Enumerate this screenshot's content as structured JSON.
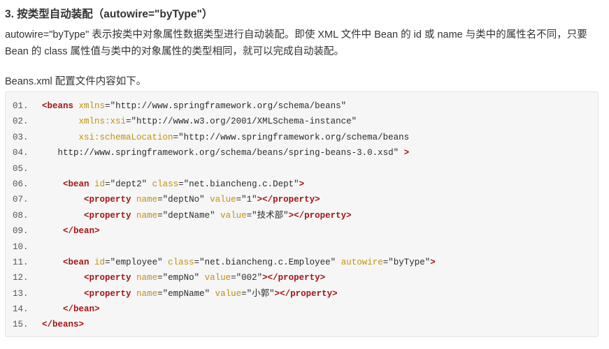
{
  "heading": "3. 按类型自动装配（autowire=\"byType\"）",
  "paragraph": [
    "autowire=\"byType\" 表示按类中对象属性数据类型进行自动装配。即使 XML 文件中 Bean 的 id 或 name 与类中的属性名不同，只要",
    "Bean 的 class 属性值与类中的对象属性的类型相同，就可以完成自动装配。"
  ],
  "intro": "Beans.xml 配置文件内容如下。",
  "code": {
    "language": "xml",
    "lines": [
      {
        "num": "01.",
        "tokens": [
          [
            "t",
            "<beans"
          ],
          [
            "p",
            " "
          ],
          [
            "a",
            "xmlns"
          ],
          [
            "p",
            "="
          ],
          [
            "v",
            "\"http://www.springframework.org/schema/beans\""
          ]
        ]
      },
      {
        "num": "02.",
        "tokens": [
          [
            "p",
            "       "
          ],
          [
            "a",
            "xmlns:xsi"
          ],
          [
            "p",
            "="
          ],
          [
            "v",
            "\"http://www.w3.org/2001/XMLSchema-instance\""
          ]
        ]
      },
      {
        "num": "03.",
        "tokens": [
          [
            "p",
            "       "
          ],
          [
            "a",
            "xsi:schemaLocation"
          ],
          [
            "p",
            "="
          ],
          [
            "v",
            "\"http://www.springframework.org/schema/beans"
          ]
        ]
      },
      {
        "num": "04.",
        "tokens": [
          [
            "v",
            "   http://www.springframework.org/schema/beans/spring-beans-3.0.xsd\""
          ],
          [
            "p",
            " "
          ],
          [
            "t",
            ">"
          ]
        ]
      },
      {
        "num": "05.",
        "tokens": []
      },
      {
        "num": "06.",
        "tokens": [
          [
            "p",
            "    "
          ],
          [
            "t",
            "<bean"
          ],
          [
            "p",
            " "
          ],
          [
            "a",
            "id"
          ],
          [
            "p",
            "="
          ],
          [
            "v",
            "\"dept2\""
          ],
          [
            "p",
            " "
          ],
          [
            "a",
            "class"
          ],
          [
            "p",
            "="
          ],
          [
            "v",
            "\"net.biancheng.c.Dept\""
          ],
          [
            "t",
            ">"
          ]
        ]
      },
      {
        "num": "07.",
        "tokens": [
          [
            "p",
            "        "
          ],
          [
            "t",
            "<property"
          ],
          [
            "p",
            " "
          ],
          [
            "a",
            "name"
          ],
          [
            "p",
            "="
          ],
          [
            "v",
            "\"deptNo\""
          ],
          [
            "p",
            " "
          ],
          [
            "a",
            "value"
          ],
          [
            "p",
            "="
          ],
          [
            "v",
            "\"1\""
          ],
          [
            "t",
            "></property>"
          ]
        ]
      },
      {
        "num": "08.",
        "tokens": [
          [
            "p",
            "        "
          ],
          [
            "t",
            "<property"
          ],
          [
            "p",
            " "
          ],
          [
            "a",
            "name"
          ],
          [
            "p",
            "="
          ],
          [
            "v",
            "\"deptName\""
          ],
          [
            "p",
            " "
          ],
          [
            "a",
            "value"
          ],
          [
            "p",
            "="
          ],
          [
            "v",
            "\"技术部\""
          ],
          [
            "t",
            "></property>"
          ]
        ]
      },
      {
        "num": "09.",
        "tokens": [
          [
            "p",
            "    "
          ],
          [
            "t",
            "</bean>"
          ]
        ]
      },
      {
        "num": "10.",
        "tokens": []
      },
      {
        "num": "11.",
        "tokens": [
          [
            "p",
            "    "
          ],
          [
            "t",
            "<bean"
          ],
          [
            "p",
            " "
          ],
          [
            "a",
            "id"
          ],
          [
            "p",
            "="
          ],
          [
            "v",
            "\"employee\""
          ],
          [
            "p",
            " "
          ],
          [
            "a",
            "class"
          ],
          [
            "p",
            "="
          ],
          [
            "v",
            "\"net.biancheng.c.Employee\""
          ],
          [
            "p",
            " "
          ],
          [
            "a",
            "autowire"
          ],
          [
            "p",
            "="
          ],
          [
            "v",
            "\"byType\""
          ],
          [
            "t",
            ">"
          ]
        ]
      },
      {
        "num": "12.",
        "tokens": [
          [
            "p",
            "        "
          ],
          [
            "t",
            "<property"
          ],
          [
            "p",
            " "
          ],
          [
            "a",
            "name"
          ],
          [
            "p",
            "="
          ],
          [
            "v",
            "\"empNo\""
          ],
          [
            "p",
            " "
          ],
          [
            "a",
            "value"
          ],
          [
            "p",
            "="
          ],
          [
            "v",
            "\"002\""
          ],
          [
            "t",
            "></property>"
          ]
        ]
      },
      {
        "num": "13.",
        "tokens": [
          [
            "p",
            "        "
          ],
          [
            "t",
            "<property"
          ],
          [
            "p",
            " "
          ],
          [
            "a",
            "name"
          ],
          [
            "p",
            "="
          ],
          [
            "v",
            "\"empName\""
          ],
          [
            "p",
            " "
          ],
          [
            "a",
            "value"
          ],
          [
            "p",
            "="
          ],
          [
            "v",
            "\"小郭\""
          ],
          [
            "t",
            "></property>"
          ]
        ]
      },
      {
        "num": "14.",
        "tokens": [
          [
            "p",
            "    "
          ],
          [
            "t",
            "</bean>"
          ]
        ]
      },
      {
        "num": "15.",
        "tokens": [
          [
            "t",
            "</beans>"
          ]
        ]
      }
    ]
  },
  "colors": {
    "tag": "#a31515",
    "attribute": "#c1920b",
    "value": "#2b2b2b",
    "code_background": "#f6f6f6"
  }
}
